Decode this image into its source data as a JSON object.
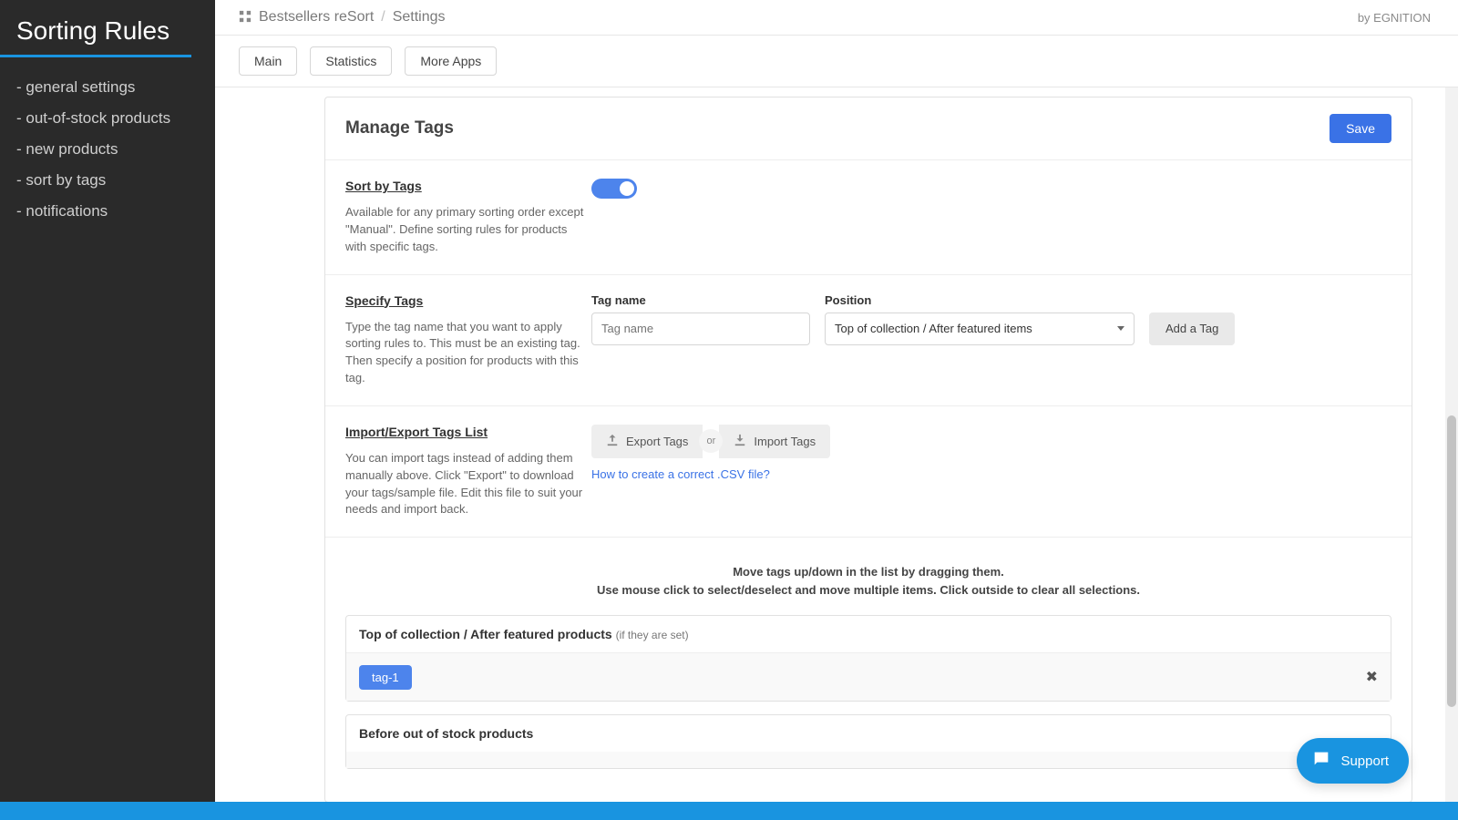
{
  "sidebar": {
    "title": "Sorting Rules",
    "items": [
      {
        "label": "- general settings"
      },
      {
        "label": "- out-of-stock products"
      },
      {
        "label": "- new products"
      },
      {
        "label": "- sort by tags"
      },
      {
        "label": "- notifications"
      }
    ]
  },
  "header": {
    "breadcrumb_app": "Bestsellers reSort",
    "breadcrumb_current": "Settings",
    "byline": "by EGNITION"
  },
  "tabs": [
    {
      "label": "Main"
    },
    {
      "label": "Statistics"
    },
    {
      "label": "More Apps"
    }
  ],
  "panel": {
    "title": "Manage Tags",
    "save": "Save"
  },
  "sort_by_tags": {
    "heading": "Sort by Tags",
    "desc": "Available for any primary sorting order except \"Manual\". Define sorting rules for products with specific tags.",
    "enabled": true
  },
  "specify": {
    "heading": "Specify Tags",
    "desc": "Type the tag name that you want to apply sorting rules to. This must be an existing tag. Then specify a position for products with this tag.",
    "tagname_label": "Tag name",
    "tagname_placeholder": "Tag name",
    "position_label": "Position",
    "position_value": "Top of collection / After featured items",
    "add_btn": "Add a Tag"
  },
  "import_export": {
    "heading": "Import/Export Tags List",
    "desc": "You can import tags instead of adding them manually above. Click \"Export\" to download your tags/sample file. Edit this file to suit your needs and import back.",
    "export_btn": "Export Tags",
    "or": "or",
    "import_btn": "Import Tags",
    "howto": "How to create a correct .CSV file?"
  },
  "drag_hint": {
    "line1": "Move tags up/down in the list by dragging them.",
    "line2": "Use mouse click to select/deselect and move multiple items. Click outside to clear all selections."
  },
  "zones": [
    {
      "title": "Top of collection / After featured products",
      "sub": "(if they are set)",
      "tags": [
        "tag-1"
      ],
      "closable": true
    },
    {
      "title": "Before out of stock products",
      "sub": "",
      "tags": [],
      "closable": false
    }
  ],
  "support": {
    "label": "Support"
  },
  "colors": {
    "accent": "#1994e0",
    "primary_btn": "#3a72e6",
    "chip": "#4d84ec",
    "sidebar_bg": "#2a2a2a"
  }
}
